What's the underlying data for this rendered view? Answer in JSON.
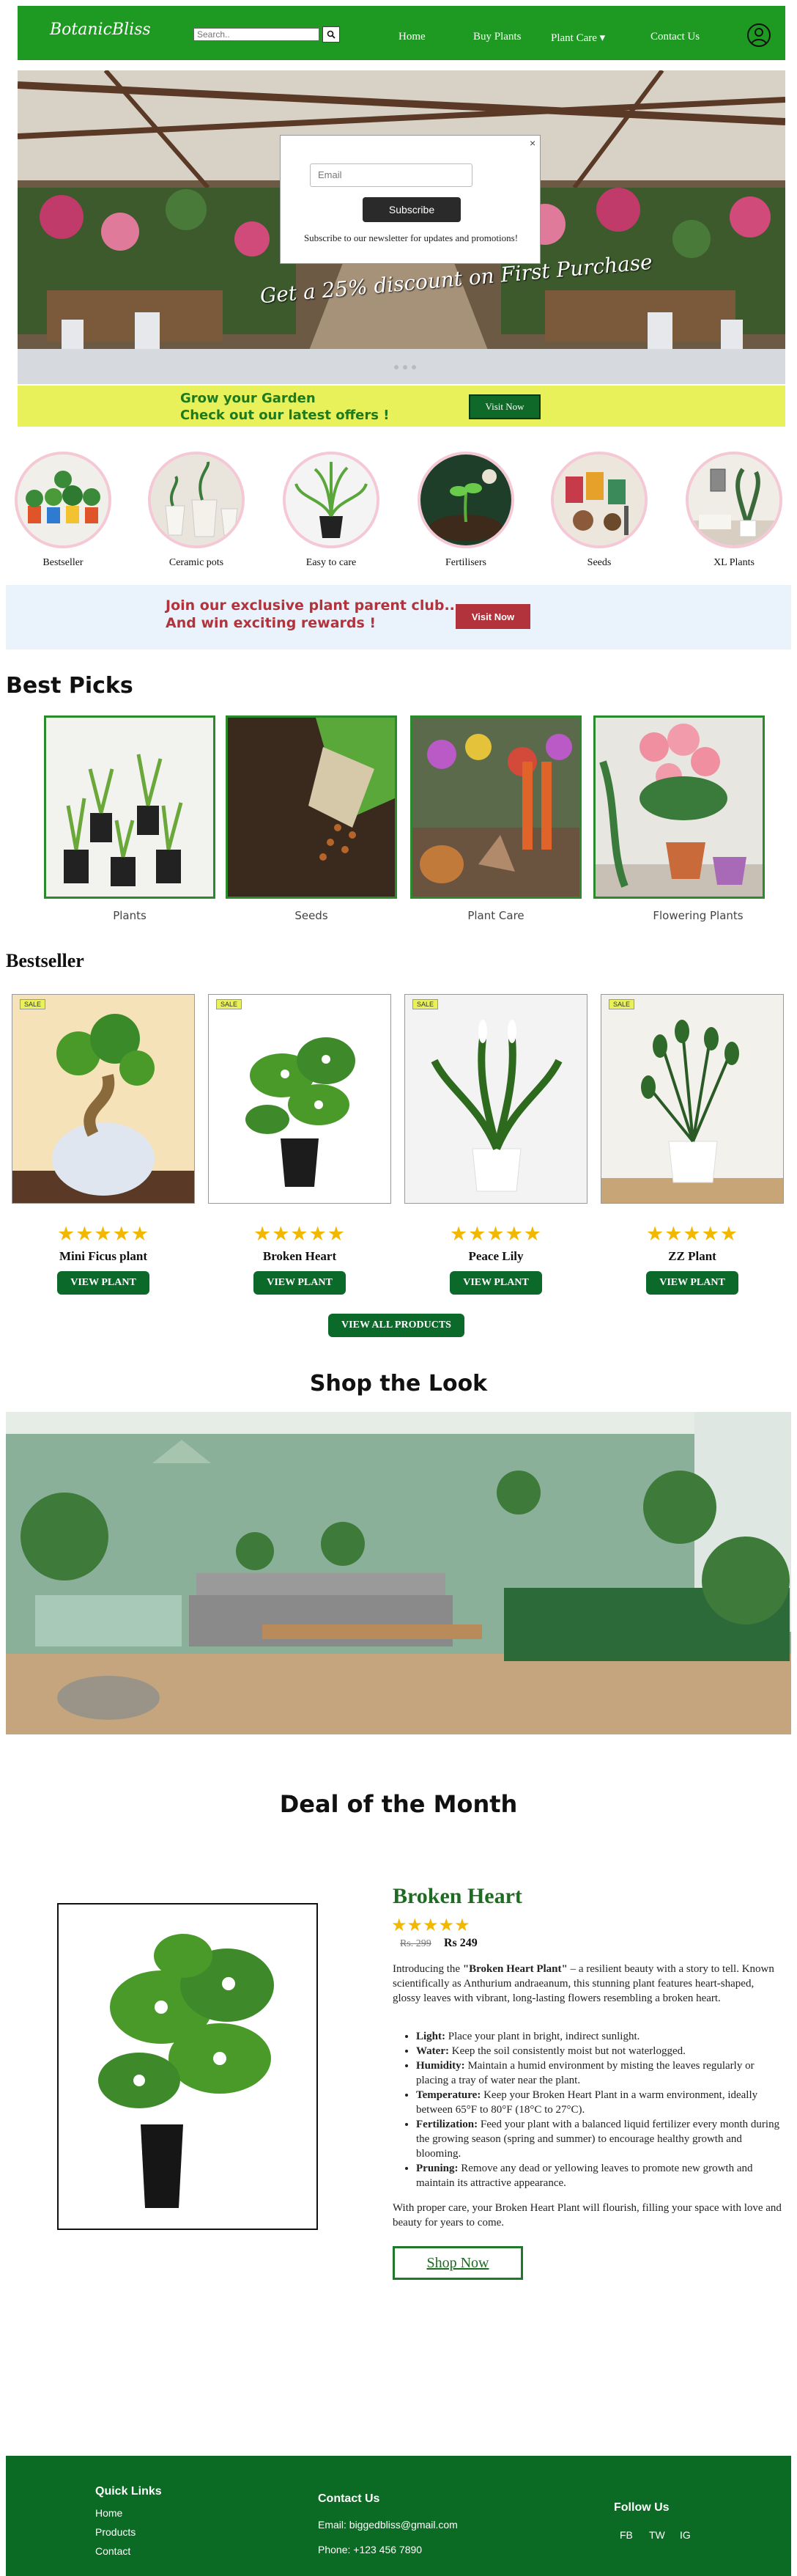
{
  "navbar": {
    "logo": "BotanicBliss",
    "search_placeholder": "Search..",
    "search_icon": "search-icon",
    "links": [
      "Home",
      "Buy Plants",
      "Plant Care ▾",
      "Contact Us"
    ],
    "user_icon": "user-icon",
    "bg_color": "#1e9a22"
  },
  "hero": {
    "caption": "Get a 25% discount on First Purchase",
    "popup": {
      "close": "×",
      "email_placeholder": "Email",
      "button": "Subscribe",
      "note": "Subscribe to our newsletter for updates and promotions!"
    }
  },
  "promo": {
    "line1": "Grow your Garden",
    "line2": "Check out our latest offers !",
    "button": "Visit Now"
  },
  "categories": [
    "Bestseller",
    "Ceramic pots",
    "Easy to care",
    "Fertilisers",
    "Seeds",
    "XL Plants"
  ],
  "club": {
    "line1": "Join our exclusive plant parent club..",
    "line2": "And win exciting rewards !",
    "button": "Visit Now"
  },
  "best_picks": {
    "title": "Best Picks",
    "items": [
      "Plants",
      "Seeds",
      "Plant Care",
      "Flowering Plants"
    ]
  },
  "bestseller": {
    "title": "Bestseller",
    "sale_badge": "SALE",
    "stars": "★★★★★",
    "rating": 5,
    "products": [
      "Mini Ficus plant",
      "Broken Heart",
      "Peace Lily",
      "ZZ Plant"
    ],
    "view_button": "VIEW PLANT",
    "view_all": "VIEW ALL PRODUCTS"
  },
  "shop_the_look": {
    "title": "Shop the Look"
  },
  "deal": {
    "title": "Deal of the Month",
    "name": "Broken Heart",
    "stars": "★★★★★",
    "old_price": "Rs. 299",
    "new_price": "Rs 249",
    "desc_pre": "Introducing the ",
    "desc_bold": "\"Broken Heart Plant\"",
    "desc_post": " – a resilient beauty with a story to tell. Known scientifically as Anthurium andraeanum, this stunning plant features heart-shaped, glossy leaves with vibrant, long-lasting flowers resembling a broken heart.",
    "care": [
      {
        "k": "Light:",
        "v": " Place your plant in bright, indirect sunlight."
      },
      {
        "k": "Water:",
        "v": " Keep the soil consistently moist but not waterlogged."
      },
      {
        "k": "Humidity:",
        "v": " Maintain a humid environment by misting the leaves regularly or placing a tray of water near the plant."
      },
      {
        "k": "Temperature:",
        "v": " Keep your Broken Heart Plant in a warm environment, ideally between 65°F to 80°F (18°C to 27°C)."
      },
      {
        "k": "Fertilization:",
        "v": " Feed your plant with a balanced liquid fertilizer every month during the growing season (spring and summer) to encourage healthy growth and blooming."
      },
      {
        "k": "Pruning:",
        "v": " Remove any dead or yellowing leaves to promote new growth and maintain its attractive appearance."
      }
    ],
    "outro": "With proper care, your Broken Heart Plant will flourish, filling your space with love and beauty for years to come.",
    "button": "Shop Now"
  },
  "footer": {
    "quick_links_title": "Quick Links",
    "quick_links": [
      "Home",
      "Products",
      "Contact"
    ],
    "contact_title": "Contact Us",
    "email": "Email: biggedbliss@gmail.com",
    "phone": "Phone: +123 456 7890",
    "follow_title": "Follow Us",
    "social": [
      "FB",
      "TW",
      "IG"
    ],
    "bg_color": "#0b6a23"
  }
}
